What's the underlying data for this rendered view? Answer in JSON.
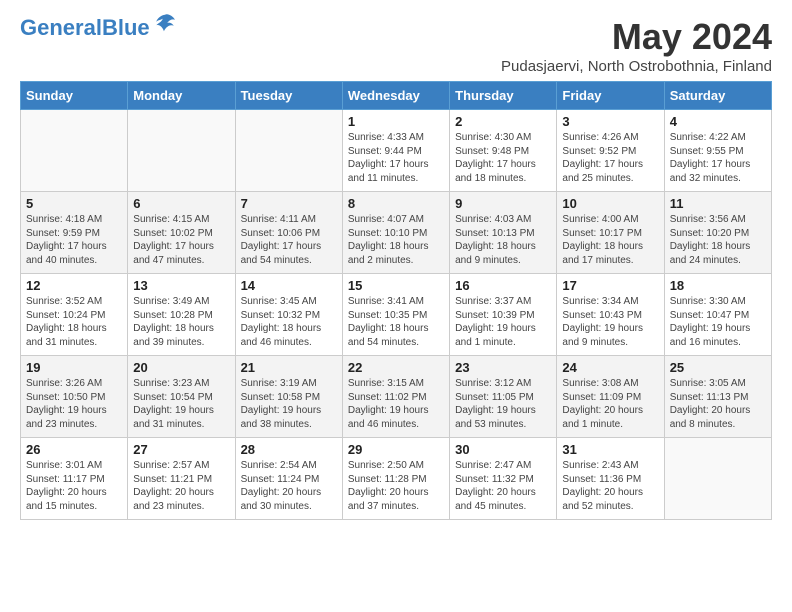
{
  "header": {
    "logo_line1": "General",
    "logo_line2": "Blue",
    "month": "May 2024",
    "location": "Pudasjaervi, North Ostrobothnia, Finland"
  },
  "weekdays": [
    "Sunday",
    "Monday",
    "Tuesday",
    "Wednesday",
    "Thursday",
    "Friday",
    "Saturday"
  ],
  "weeks": [
    [
      {
        "day": "",
        "info": ""
      },
      {
        "day": "",
        "info": ""
      },
      {
        "day": "",
        "info": ""
      },
      {
        "day": "1",
        "info": "Sunrise: 4:33 AM\nSunset: 9:44 PM\nDaylight: 17 hours\nand 11 minutes."
      },
      {
        "day": "2",
        "info": "Sunrise: 4:30 AM\nSunset: 9:48 PM\nDaylight: 17 hours\nand 18 minutes."
      },
      {
        "day": "3",
        "info": "Sunrise: 4:26 AM\nSunset: 9:52 PM\nDaylight: 17 hours\nand 25 minutes."
      },
      {
        "day": "4",
        "info": "Sunrise: 4:22 AM\nSunset: 9:55 PM\nDaylight: 17 hours\nand 32 minutes."
      }
    ],
    [
      {
        "day": "5",
        "info": "Sunrise: 4:18 AM\nSunset: 9:59 PM\nDaylight: 17 hours\nand 40 minutes."
      },
      {
        "day": "6",
        "info": "Sunrise: 4:15 AM\nSunset: 10:02 PM\nDaylight: 17 hours\nand 47 minutes."
      },
      {
        "day": "7",
        "info": "Sunrise: 4:11 AM\nSunset: 10:06 PM\nDaylight: 17 hours\nand 54 minutes."
      },
      {
        "day": "8",
        "info": "Sunrise: 4:07 AM\nSunset: 10:10 PM\nDaylight: 18 hours\nand 2 minutes."
      },
      {
        "day": "9",
        "info": "Sunrise: 4:03 AM\nSunset: 10:13 PM\nDaylight: 18 hours\nand 9 minutes."
      },
      {
        "day": "10",
        "info": "Sunrise: 4:00 AM\nSunset: 10:17 PM\nDaylight: 18 hours\nand 17 minutes."
      },
      {
        "day": "11",
        "info": "Sunrise: 3:56 AM\nSunset: 10:20 PM\nDaylight: 18 hours\nand 24 minutes."
      }
    ],
    [
      {
        "day": "12",
        "info": "Sunrise: 3:52 AM\nSunset: 10:24 PM\nDaylight: 18 hours\nand 31 minutes."
      },
      {
        "day": "13",
        "info": "Sunrise: 3:49 AM\nSunset: 10:28 PM\nDaylight: 18 hours\nand 39 minutes."
      },
      {
        "day": "14",
        "info": "Sunrise: 3:45 AM\nSunset: 10:32 PM\nDaylight: 18 hours\nand 46 minutes."
      },
      {
        "day": "15",
        "info": "Sunrise: 3:41 AM\nSunset: 10:35 PM\nDaylight: 18 hours\nand 54 minutes."
      },
      {
        "day": "16",
        "info": "Sunrise: 3:37 AM\nSunset: 10:39 PM\nDaylight: 19 hours\nand 1 minute."
      },
      {
        "day": "17",
        "info": "Sunrise: 3:34 AM\nSunset: 10:43 PM\nDaylight: 19 hours\nand 9 minutes."
      },
      {
        "day": "18",
        "info": "Sunrise: 3:30 AM\nSunset: 10:47 PM\nDaylight: 19 hours\nand 16 minutes."
      }
    ],
    [
      {
        "day": "19",
        "info": "Sunrise: 3:26 AM\nSunset: 10:50 PM\nDaylight: 19 hours\nand 23 minutes."
      },
      {
        "day": "20",
        "info": "Sunrise: 3:23 AM\nSunset: 10:54 PM\nDaylight: 19 hours\nand 31 minutes."
      },
      {
        "day": "21",
        "info": "Sunrise: 3:19 AM\nSunset: 10:58 PM\nDaylight: 19 hours\nand 38 minutes."
      },
      {
        "day": "22",
        "info": "Sunrise: 3:15 AM\nSunset: 11:02 PM\nDaylight: 19 hours\nand 46 minutes."
      },
      {
        "day": "23",
        "info": "Sunrise: 3:12 AM\nSunset: 11:05 PM\nDaylight: 19 hours\nand 53 minutes."
      },
      {
        "day": "24",
        "info": "Sunrise: 3:08 AM\nSunset: 11:09 PM\nDaylight: 20 hours\nand 1 minute."
      },
      {
        "day": "25",
        "info": "Sunrise: 3:05 AM\nSunset: 11:13 PM\nDaylight: 20 hours\nand 8 minutes."
      }
    ],
    [
      {
        "day": "26",
        "info": "Sunrise: 3:01 AM\nSunset: 11:17 PM\nDaylight: 20 hours\nand 15 minutes."
      },
      {
        "day": "27",
        "info": "Sunrise: 2:57 AM\nSunset: 11:21 PM\nDaylight: 20 hours\nand 23 minutes."
      },
      {
        "day": "28",
        "info": "Sunrise: 2:54 AM\nSunset: 11:24 PM\nDaylight: 20 hours\nand 30 minutes."
      },
      {
        "day": "29",
        "info": "Sunrise: 2:50 AM\nSunset: 11:28 PM\nDaylight: 20 hours\nand 37 minutes."
      },
      {
        "day": "30",
        "info": "Sunrise: 2:47 AM\nSunset: 11:32 PM\nDaylight: 20 hours\nand 45 minutes."
      },
      {
        "day": "31",
        "info": "Sunrise: 2:43 AM\nSunset: 11:36 PM\nDaylight: 20 hours\nand 52 minutes."
      },
      {
        "day": "",
        "info": ""
      }
    ]
  ]
}
